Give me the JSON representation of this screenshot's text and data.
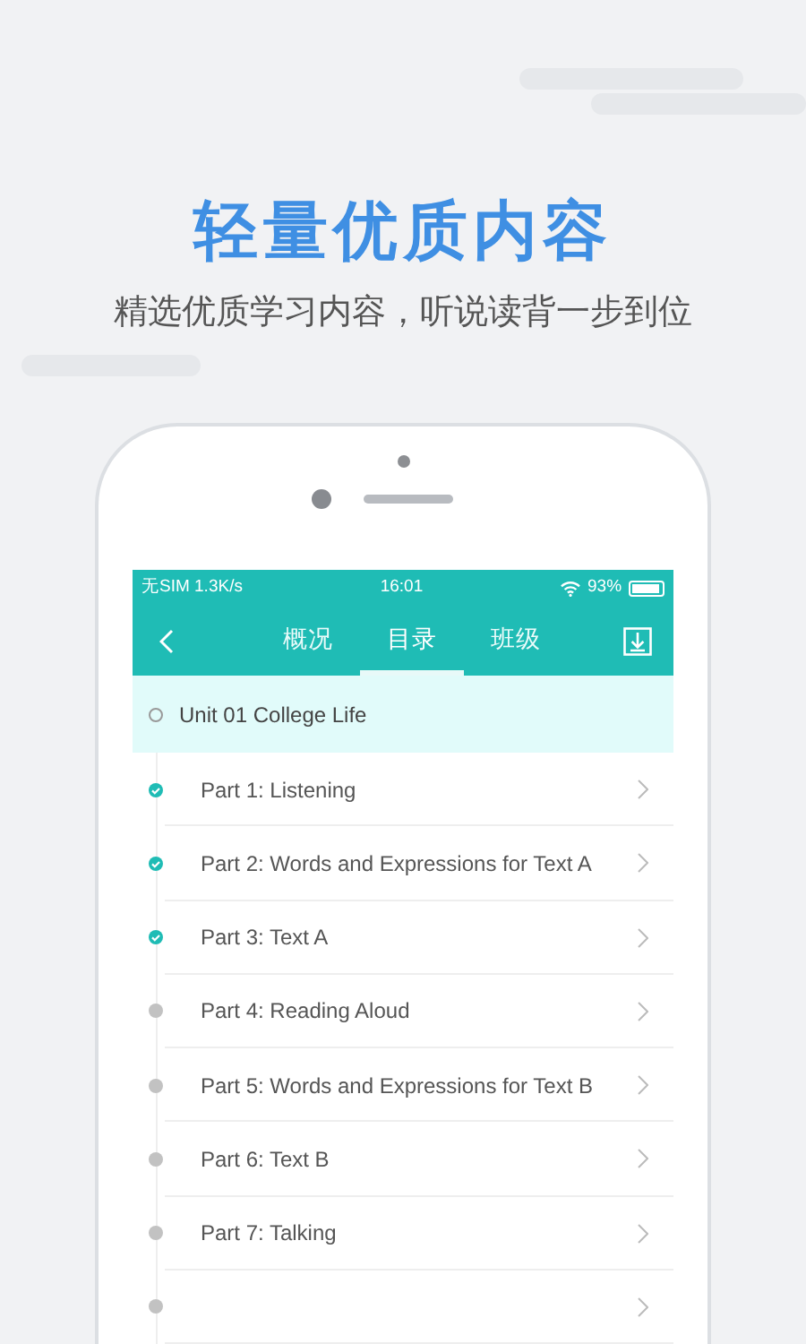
{
  "headline": "轻量优质内容",
  "tagline": "精选优质学习内容，听说读背一步到位",
  "status_bar": {
    "carrier": "无SIM 1.3K/s",
    "time": "16:01",
    "battery": "93%"
  },
  "nav": {
    "tabs": [
      {
        "label": "概况",
        "selected": false
      },
      {
        "label": "目录",
        "selected": true
      },
      {
        "label": "班级",
        "selected": false
      }
    ]
  },
  "unit": {
    "title": "Unit 01 College Life"
  },
  "parts": [
    {
      "title": "Part 1: Listening",
      "completed": true
    },
    {
      "title": "Part 2: Words and Expressions for Text A",
      "completed": true
    },
    {
      "title": "Part 3: Text A",
      "completed": true
    },
    {
      "title": "Part 4: Reading Aloud",
      "completed": false
    },
    {
      "title": "Part 5: Words and Expressions for Text B",
      "completed": false
    },
    {
      "title": "Part 6: Text B",
      "completed": false
    },
    {
      "title": "Part 7: Talking",
      "completed": false
    },
    {
      "completed": false
    }
  ]
}
